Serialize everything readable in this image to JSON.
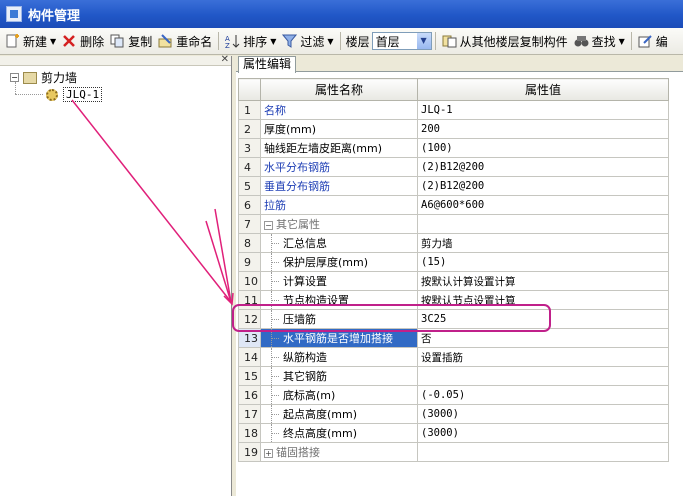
{
  "window": {
    "title": "构件管理"
  },
  "toolbar": {
    "new_label": "新建",
    "delete_label": "删除",
    "copy_label": "复制",
    "rename_label": "重命名",
    "sort_label": "排序",
    "filter_label": "过滤",
    "floor_label": "楼层",
    "floor_value": "首层",
    "copy_from_floor_label": "从其他楼层复制构件",
    "find_label": "查找",
    "edit_partial_label": "编"
  },
  "tree": {
    "root_label": "剪力墙",
    "child_label": "JLQ-1",
    "close_glyph": "✕",
    "root_expander": "−"
  },
  "tabs": {
    "properties_label": "属性编辑"
  },
  "grid": {
    "headers": {
      "name": "属性名称",
      "value": "属性值"
    },
    "rows": [
      {
        "no": "1",
        "name": "名称",
        "value": "JLQ-1"
      },
      {
        "no": "2",
        "name": "厚度(mm)",
        "value": "200"
      },
      {
        "no": "3",
        "name": "轴线距左墙皮距离(mm)",
        "value": "(100)"
      },
      {
        "no": "4",
        "name": "水平分布钢筋",
        "value": "(2)B12@200"
      },
      {
        "no": "5",
        "name": "垂直分布钢筋",
        "value": "(2)B12@200"
      },
      {
        "no": "6",
        "name": "拉筋",
        "value": "A6@600*600"
      },
      {
        "no": "7",
        "name": "其它属性",
        "value": "",
        "expander": "−"
      },
      {
        "no": "8",
        "name": "汇总信息",
        "value": "剪力墙"
      },
      {
        "no": "9",
        "name": "保护层厚度(mm)",
        "value": "(15)"
      },
      {
        "no": "10",
        "name": "计算设置",
        "value": "按默认计算设置计算"
      },
      {
        "no": "11",
        "name": "节点构造设置",
        "value": "按默认节点设置计算"
      },
      {
        "no": "12",
        "name": "压墙筋",
        "value": "3C25"
      },
      {
        "no": "13",
        "name": "水平钢筋是否增加搭接",
        "value": "否"
      },
      {
        "no": "14",
        "name": "纵筋构造",
        "value": "设置插筋"
      },
      {
        "no": "15",
        "name": "其它钢筋",
        "value": ""
      },
      {
        "no": "16",
        "name": "底标高(m)",
        "value": "(-0.05)"
      },
      {
        "no": "17",
        "name": "起点高度(mm)",
        "value": "(3000)"
      },
      {
        "no": "18",
        "name": "终点高度(mm)",
        "value": "(3000)"
      },
      {
        "no": "19",
        "name": "锚固搭接",
        "value": "",
        "expander": "+"
      }
    ]
  },
  "colors": {
    "title_bar": "#2157c7",
    "selection": "#316ac5",
    "annotation_arrow": "#e0207a",
    "highlight_box": "#c0208a",
    "blue_property_text": "#1f3fb5"
  }
}
